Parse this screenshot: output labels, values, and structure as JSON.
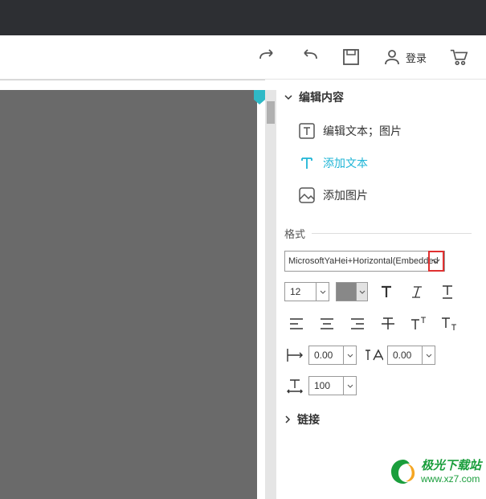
{
  "toolbar": {
    "login_label": "登录"
  },
  "panel": {
    "edit_section": "编辑内容",
    "tools": {
      "edit_text_image": "编辑文本；图片",
      "add_text": "添加文本",
      "add_image": "添加图片"
    },
    "format_label": "格式",
    "font_name": "MicrosoftYaHei+Horizontal(Embedded",
    "font_size": "12",
    "spacing": {
      "width_val": "0.00",
      "height_val": "0.00",
      "scale_val": "100"
    },
    "link_section": "链接"
  },
  "watermark": {
    "title": "极光下载站",
    "url": "www.xz7.com"
  }
}
